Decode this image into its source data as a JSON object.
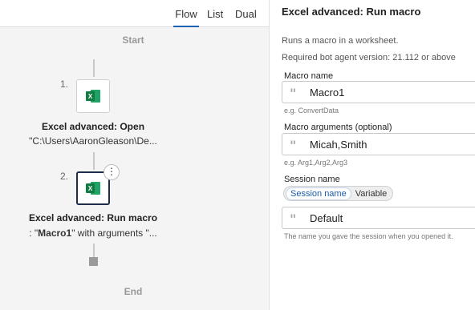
{
  "view_tabs": {
    "flow": "Flow",
    "list": "List",
    "dual": "Dual",
    "active": "Flow"
  },
  "flow": {
    "start": "Start",
    "end": "End",
    "steps": [
      {
        "number": "1.",
        "icon": "excel-icon",
        "title": "Excel advanced: Open",
        "subtitle": "\"C:\\Users\\AaronGleason\\De..."
      },
      {
        "number": "2.",
        "icon": "excel-icon",
        "title": "Excel advanced: Run macro",
        "subtitle_prefix": ": \"",
        "subtitle_bold": "Macro1",
        "subtitle_suffix": "\" with arguments \"...",
        "more": "⋮"
      }
    ]
  },
  "details": {
    "title": "Excel advanced: Run macro",
    "description": "Runs a macro in a worksheet.",
    "requirement": "Required bot agent version: 21.112 or above",
    "macro_name": {
      "label": "Macro name",
      "value": "Macro1",
      "hint": "e.g. ConvertData"
    },
    "macro_args": {
      "label": "Macro arguments (optional)",
      "value": "Micah,Smith",
      "hint": "e.g. Arg1,Arg2,Arg3"
    },
    "session": {
      "label": "Session name",
      "toggle_session": "Session name",
      "toggle_variable": "Variable",
      "value": "Default",
      "hint": "The name you gave the session when you opened it."
    }
  },
  "colors": {
    "accent": "#1a62b3",
    "excel_dark": "#107c41",
    "excel_light": "#21a366",
    "selected_border": "#1f2d4a"
  }
}
